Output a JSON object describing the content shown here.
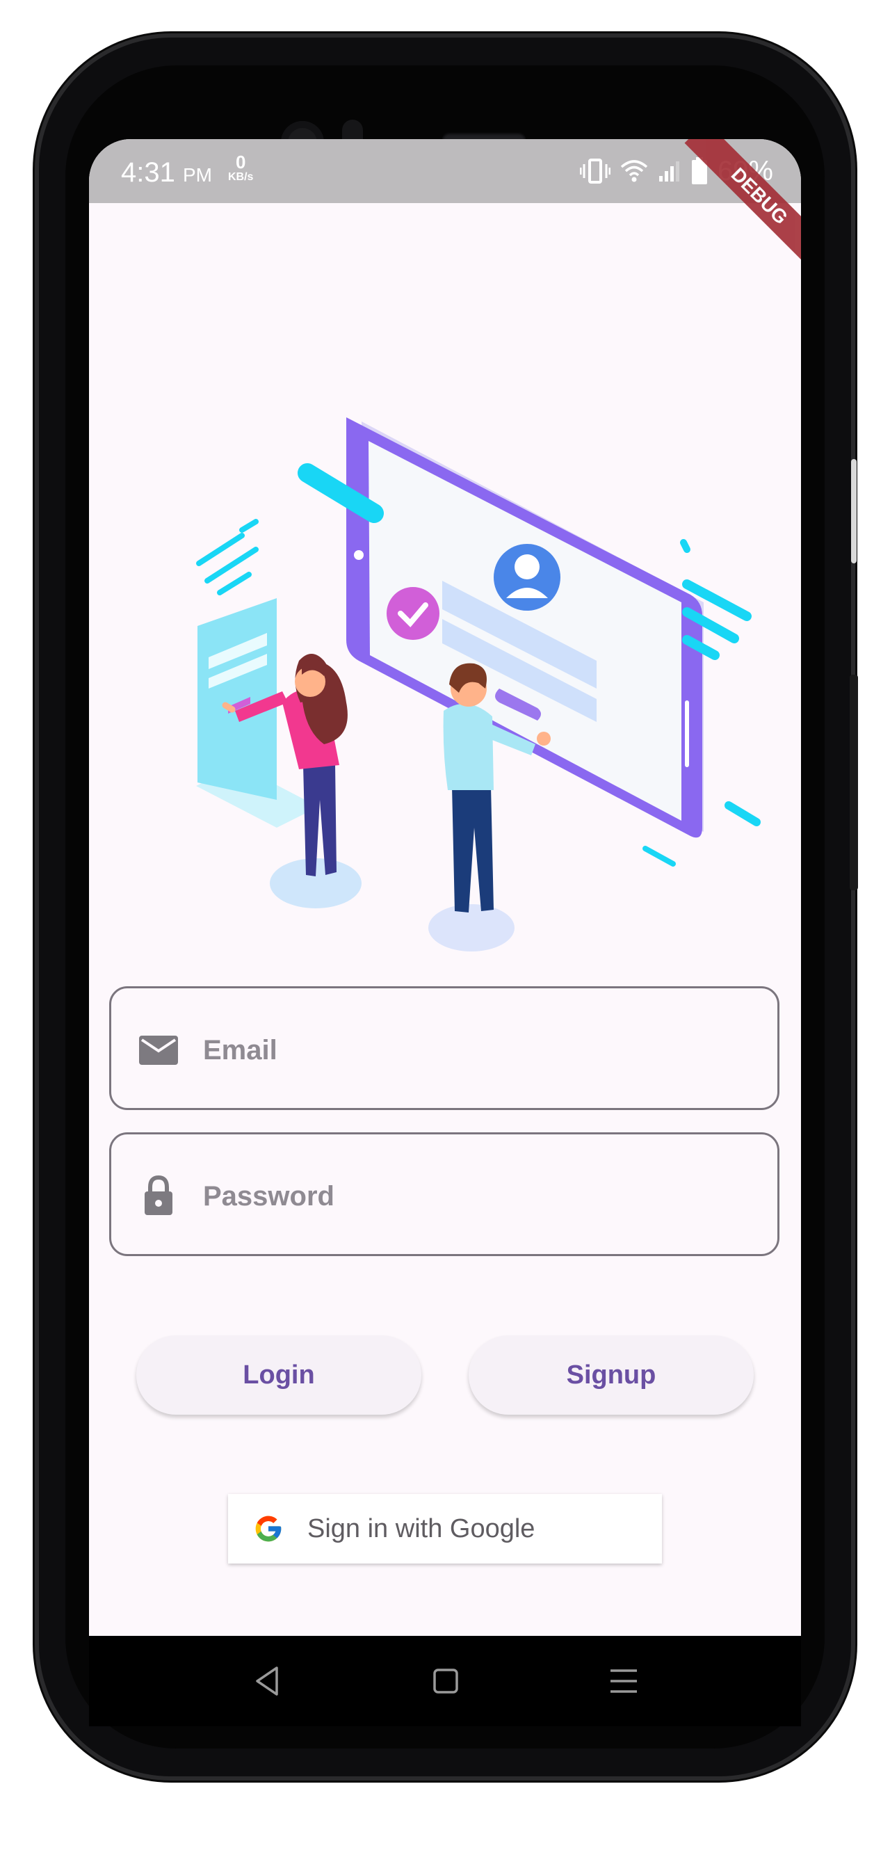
{
  "status_bar": {
    "time": "4:31",
    "ampm": "PM",
    "net_speed_value": "0",
    "net_speed_unit": "KB/s",
    "battery": "69%",
    "icons": [
      "vibrate-icon",
      "wifi-icon",
      "signal-icon",
      "battery-icon"
    ]
  },
  "debug_banner": "DEBUG",
  "form": {
    "email_placeholder": "Email",
    "password_placeholder": "Password"
  },
  "buttons": {
    "login_label": "Login",
    "signup_label": "Signup",
    "google_label": "Sign in with Google"
  },
  "colors": {
    "accent": "#6a4fa3",
    "background": "#fdf8fc",
    "cyan": "#19d6f5",
    "purple": "#8c6cf0",
    "pink": "#f2388f"
  },
  "nav": [
    "back-icon",
    "home-icon",
    "menu-icon"
  ]
}
